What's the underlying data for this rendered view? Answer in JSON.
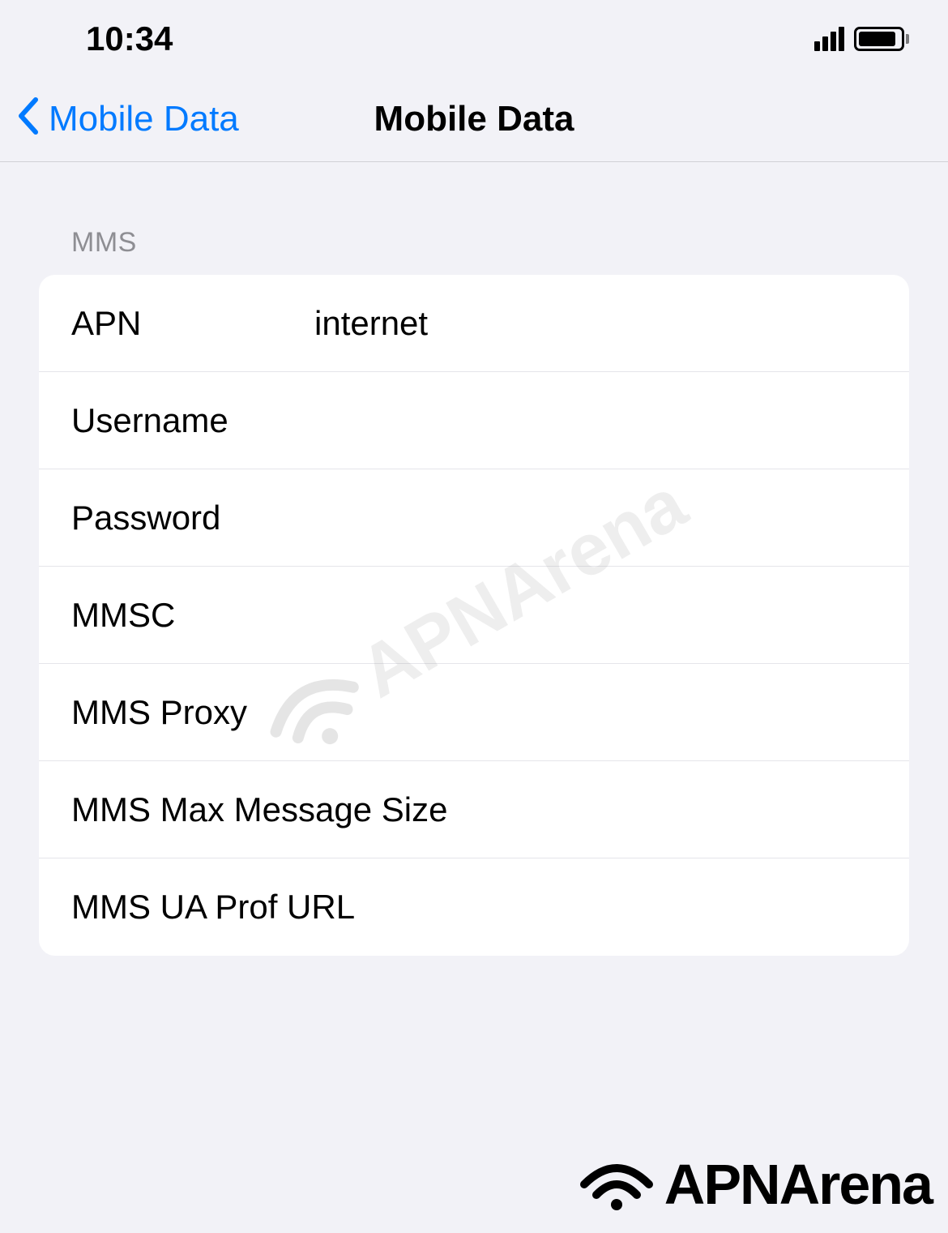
{
  "statusBar": {
    "time": "10:34"
  },
  "navBar": {
    "backLabel": "Mobile Data",
    "title": "Mobile Data"
  },
  "section": {
    "header": "MMS",
    "rows": {
      "apn": {
        "label": "APN",
        "value": "internet"
      },
      "username": {
        "label": "Username",
        "value": ""
      },
      "password": {
        "label": "Password",
        "value": ""
      },
      "mmsc": {
        "label": "MMSC",
        "value": ""
      },
      "mmsProxy": {
        "label": "MMS Proxy",
        "value": ""
      },
      "mmsMaxSize": {
        "label": "MMS Max Message Size",
        "value": ""
      },
      "mmsUaProf": {
        "label": "MMS UA Prof URL",
        "value": ""
      }
    }
  },
  "branding": {
    "watermark": "APNArena",
    "name": "APNArena"
  }
}
